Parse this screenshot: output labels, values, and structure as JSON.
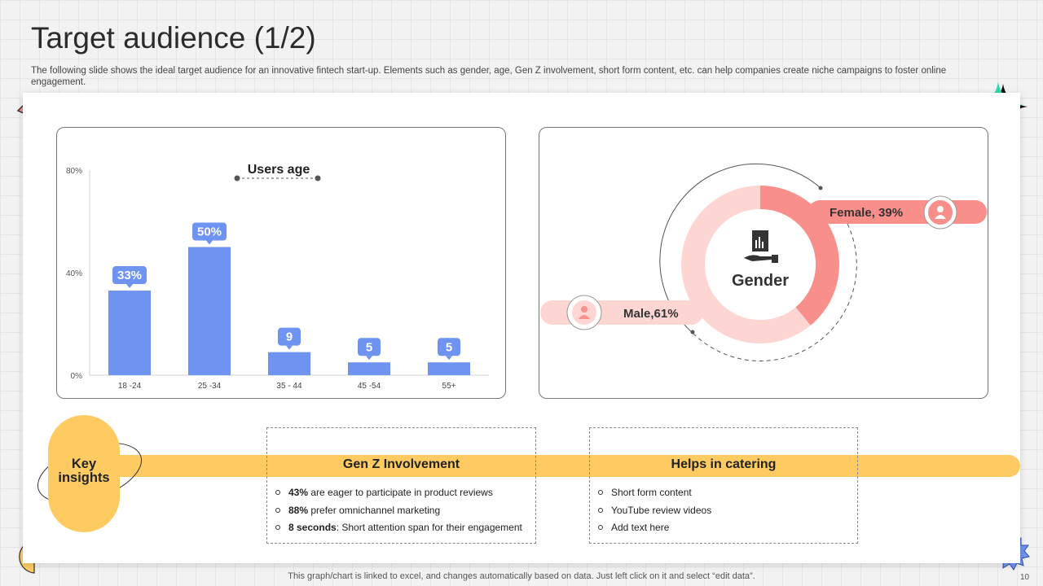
{
  "slide": {
    "title": "Target audience (1/2)",
    "subtitle": "The following slide shows the ideal target audience for an innovative fintech start-up. Elements such as gender, age, Gen Z involvement, short form content, etc. can help companies create niche campaigns to foster online engagement.",
    "footer": "This graph/chart is linked to excel,  and changes automatically based on data. Just left click on it and select “edit data”.",
    "page_number": "10"
  },
  "colors": {
    "bar": "#6f93f0",
    "female": "#f98f8b",
    "male": "#fdd6d4",
    "accent_yellow": "#fdcb62",
    "teal": "#2fd8a8"
  },
  "chart_data": [
    {
      "type": "bar",
      "title": "Users age",
      "categories": [
        "18 -24",
        "25 -34",
        "35 - 44",
        "45 -54",
        "55+"
      ],
      "values": [
        33,
        50,
        9,
        5,
        5
      ],
      "data_labels": [
        "33%",
        "50%",
        "9",
        "5",
        "5"
      ],
      "ylim": [
        0,
        80
      ],
      "y_ticks": [
        0,
        40,
        80
      ],
      "y_tick_labels": [
        "0%",
        "40%",
        "80%"
      ],
      "grid": false
    },
    {
      "type": "pie",
      "title": "Gender",
      "series": [
        {
          "name": "Female",
          "value": 39,
          "label": "Female, 39%"
        },
        {
          "name": "Male",
          "value": 61,
          "label": "Male,61%"
        }
      ]
    }
  ],
  "icons": {
    "chart": "hand-holding-chart-icon",
    "female": "user-icon",
    "male": "user-icon"
  },
  "insights": {
    "key_label_line1": "Key",
    "key_label_line2": "insights",
    "genz": {
      "title": "Gen Z Involvement",
      "items": [
        {
          "bold": "43%",
          "text": " are eager to participate in product reviews"
        },
        {
          "bold": "88%",
          "text": " prefer omnichannel marketing"
        },
        {
          "bold": "8 seconds",
          "text": ": Short attention span for their engagement"
        }
      ]
    },
    "catering": {
      "title": "Helps in catering",
      "items": [
        "Short form content",
        "YouTube review videos",
        "Add text here"
      ]
    }
  }
}
